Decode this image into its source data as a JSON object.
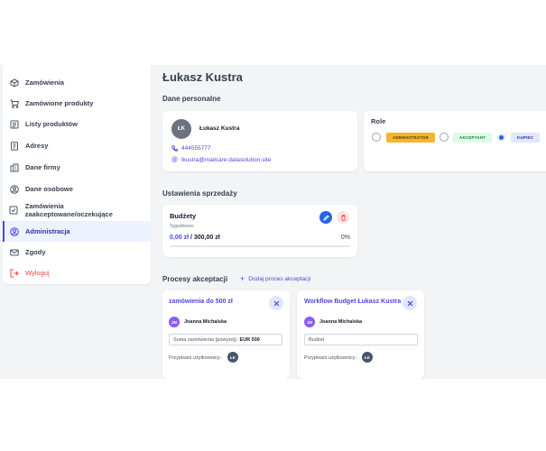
{
  "sidebar": {
    "items": [
      {
        "label": "Zamówienia",
        "icon": "box-icon"
      },
      {
        "label": "Zamówione produkty",
        "icon": "cart-icon"
      },
      {
        "label": "Listy produktów",
        "icon": "list-icon"
      },
      {
        "label": "Adresy",
        "icon": "address-card-icon"
      },
      {
        "label": "Dane firmy",
        "icon": "building-icon"
      },
      {
        "label": "Dane osobowe",
        "icon": "user-circle-icon"
      },
      {
        "label": "Zamówienia zaakceptowane/oczekujące",
        "icon": "clipboard-check-icon"
      },
      {
        "label": "Administracja",
        "icon": "user-circle-icon"
      },
      {
        "label": "Zgody",
        "icon": "envelope-icon"
      },
      {
        "label": "Wyloguj",
        "icon": "logout-icon"
      }
    ],
    "active_index": 7
  },
  "main": {
    "title": "Łukasz Kustra",
    "personal": {
      "section_title": "Dane personalne",
      "initials": "ŁK",
      "name": "Łukasz Kustra",
      "phone": "444555777",
      "email": "lkustra@mailcare.datasolution.site"
    },
    "roles": {
      "title": "Role",
      "items": [
        {
          "label": "ADMINISTRATOR",
          "bg": "#f5b52e",
          "color": "#5b3b00",
          "checked": false
        },
        {
          "label": "AKCEPTANT",
          "bg": "#dcfce7",
          "color": "#15803d",
          "checked": false
        },
        {
          "label": "KUPIEC",
          "bg": "#e0e7ff",
          "color": "#3730a3",
          "checked": true
        }
      ]
    },
    "sales": {
      "section_title": "Ustawienia sprzedaży",
      "budget_title": "Budżety",
      "period": "Tygodniowo",
      "used": "0,00 zł",
      "separator": " / ",
      "limit": "300,00 zł",
      "percent": "0%",
      "progress_fraction": 0
    },
    "processes": {
      "section_title": "Procesy akceptacji",
      "add_label": "Dodaj proces akceptacji",
      "cards": [
        {
          "title": "zamówienia do 500 zł",
          "approver_initials": "JM",
          "approver_name": "Joanna Michalska",
          "condition_label": "Suma zamówienia (powyżej): ",
          "condition_value": "EUR 500",
          "assigned_label": "Przypisani użytkownicy:",
          "assigned_initials": "ŁK"
        },
        {
          "title": "Workflow Budget Łukasz Kustra",
          "approver_initials": "JM",
          "approver_name": "Joanna Michalska",
          "condition_label": "Budżet",
          "condition_value": "",
          "assigned_label": "Przypisani użytkownicy:",
          "assigned_initials": "ŁK"
        }
      ]
    }
  },
  "colors": {
    "accent": "#4f46e5",
    "danger": "#ef4444",
    "edit_button": "#2563eb",
    "delete_button_bg": "#fee2e2"
  }
}
